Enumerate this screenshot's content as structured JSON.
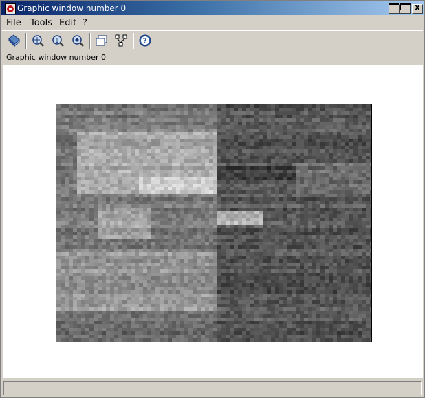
{
  "window": {
    "title": "Graphic window number 0",
    "icon": "scilab-icon",
    "controls": {
      "minimize": "minimize-icon",
      "maximize": "maximize-icon",
      "close_label": "X"
    }
  },
  "menubar": {
    "items": [
      {
        "label": "File"
      },
      {
        "label": "Tools"
      },
      {
        "label": "Edit"
      },
      {
        "label": "?"
      }
    ]
  },
  "toolbar": {
    "buttons": [
      {
        "icon": "rotate-icon"
      },
      {
        "icon": "zoom-icon"
      },
      {
        "icon": "unzoom-icon"
      },
      {
        "icon": "pan-zoom-icon"
      },
      {
        "icon": "figure-window-icon"
      },
      {
        "icon": "datatip-icon"
      },
      {
        "icon": "help-icon"
      }
    ]
  },
  "info_label": "Graphic window number 0",
  "plot": {
    "type": "grayscale-matrix-image",
    "colormap": "gray"
  },
  "statusbar": {
    "text": ""
  }
}
